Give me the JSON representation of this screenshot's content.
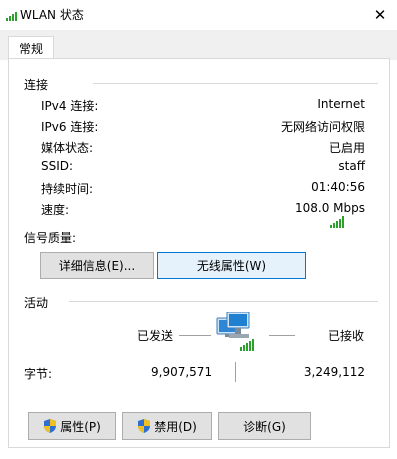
{
  "window": {
    "title": "WLAN 状态",
    "close_glyph": "✕"
  },
  "tabs": [
    {
      "label": "常规"
    }
  ],
  "connection": {
    "group_title": "连接",
    "rows": [
      {
        "label": "IPv4 连接:",
        "value": "Internet"
      },
      {
        "label": "IPv6 连接:",
        "value": "无网络访问权限"
      },
      {
        "label": "媒体状态:",
        "value": "已启用"
      },
      {
        "label": "SSID:",
        "value": "staff"
      },
      {
        "label": "持续时间:",
        "value": "01:40:56"
      },
      {
        "label": "速度:",
        "value": "108.0 Mbps"
      }
    ],
    "signal_label": "信号质量:",
    "signal_bars": 5,
    "signal_icon": "signal-strength-icon",
    "details_button": "详细信息(E)...",
    "wireless_button": "无线属性(W)"
  },
  "activity": {
    "group_title": "活动",
    "sent_label": "已发送",
    "received_label": "已接收",
    "bytes_label": "字节:",
    "bytes_sent": "9,907,571",
    "bytes_received": "3,249,112",
    "network_icon": "network-computers-icon"
  },
  "buttons": {
    "properties": "属性(P)",
    "disable": "禁用(D)",
    "diagnose": "诊断(G)",
    "shield_icon": "uac-shield-icon"
  },
  "colors": {
    "signal_green": "#2ca02c",
    "focus_border": "#0078d7",
    "focus_bg": "#e5f1fb",
    "button_bg": "#e1e1e1"
  }
}
